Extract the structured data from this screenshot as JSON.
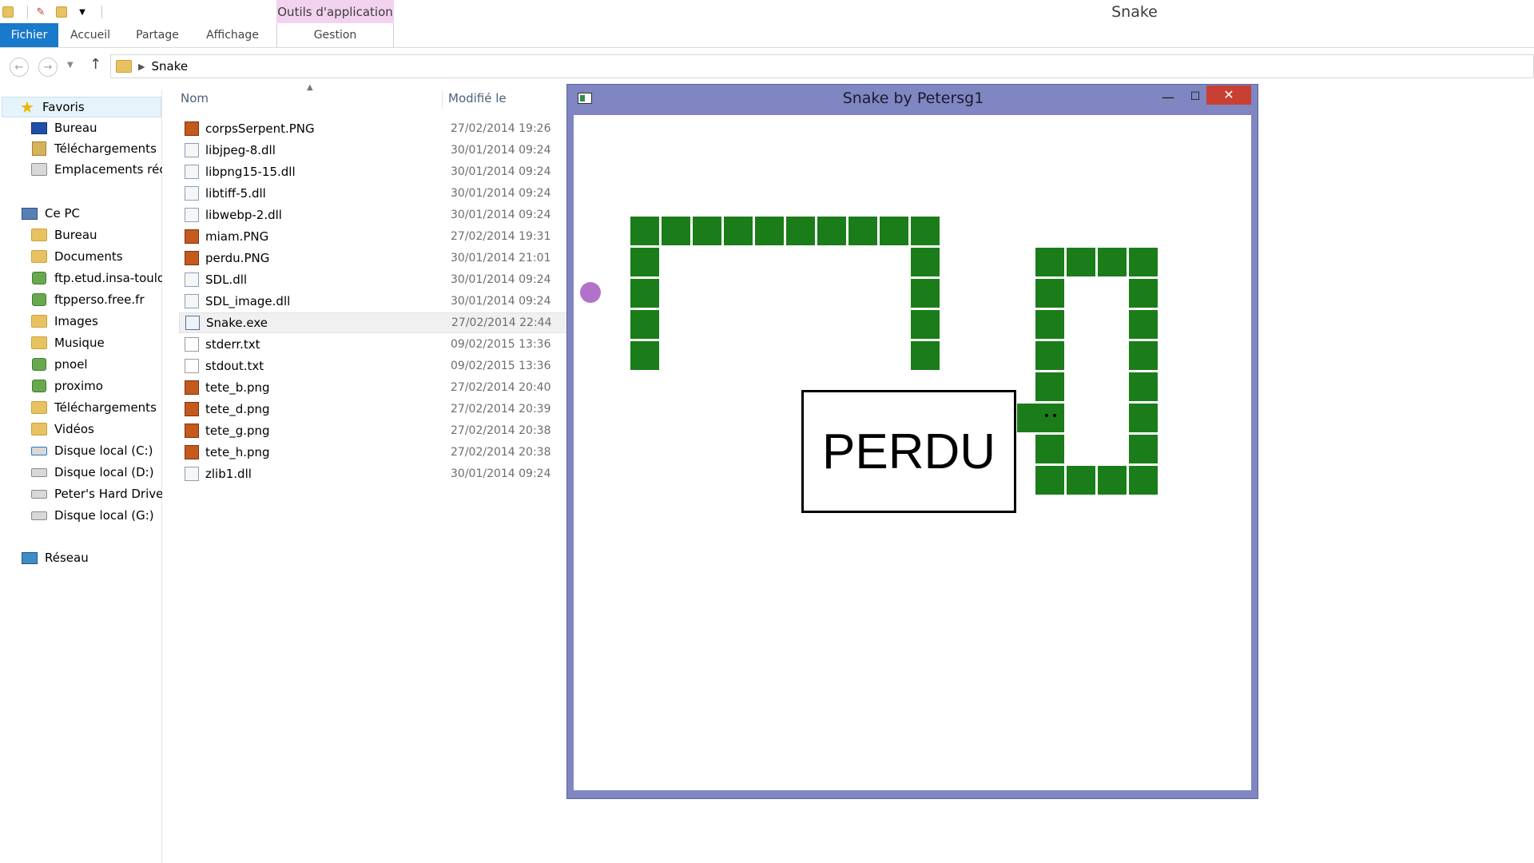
{
  "explorer": {
    "window_title": "Snake",
    "context_tab": "Outils d'application",
    "ribbon_tabs": {
      "fichier": "Fichier",
      "accueil": "Accueil",
      "partage": "Partage",
      "affichage": "Affichage",
      "gestion": "Gestion"
    },
    "address": {
      "path": "Snake"
    },
    "nav": {
      "favoris": "Favoris",
      "favoris_items": [
        "Bureau",
        "Téléchargements",
        "Emplacements récen"
      ],
      "ce_pc": "Ce PC",
      "pc_items": [
        "Bureau",
        "Documents",
        "ftp.etud.insa-toulou",
        "ftpperso.free.fr",
        "Images",
        "Musique",
        "pnoel",
        "proximo",
        "Téléchargements",
        "Vidéos",
        "Disque local (C:)",
        "Disque local (D:)",
        "Peter's Hard Drive (F",
        "Disque local (G:)"
      ],
      "reseau": "Réseau"
    },
    "columns": {
      "name": "Nom",
      "date": "Modifié le"
    },
    "files": [
      {
        "name": "corpsSerpent.PNG",
        "date": "27/02/2014 19:26",
        "type": "png"
      },
      {
        "name": "libjpeg-8.dll",
        "date": "30/01/2014 09:24",
        "type": "dll"
      },
      {
        "name": "libpng15-15.dll",
        "date": "30/01/2014 09:24",
        "type": "dll"
      },
      {
        "name": "libtiff-5.dll",
        "date": "30/01/2014 09:24",
        "type": "dll"
      },
      {
        "name": "libwebp-2.dll",
        "date": "30/01/2014 09:24",
        "type": "dll"
      },
      {
        "name": "miam.PNG",
        "date": "27/02/2014 19:31",
        "type": "png"
      },
      {
        "name": "perdu.PNG",
        "date": "30/01/2014 21:01",
        "type": "png"
      },
      {
        "name": "SDL.dll",
        "date": "30/01/2014 09:24",
        "type": "dll"
      },
      {
        "name": "SDL_image.dll",
        "date": "30/01/2014 09:24",
        "type": "dll"
      },
      {
        "name": "Snake.exe",
        "date": "27/02/2014 22:44",
        "type": "exe",
        "selected": true
      },
      {
        "name": "stderr.txt",
        "date": "09/02/2015 13:36",
        "type": "txt"
      },
      {
        "name": "stdout.txt",
        "date": "09/02/2015 13:36",
        "type": "txt"
      },
      {
        "name": "tete_b.png",
        "date": "27/02/2014 20:40",
        "type": "png"
      },
      {
        "name": "tete_d.png",
        "date": "27/02/2014 20:39",
        "type": "png"
      },
      {
        "name": "tete_g.png",
        "date": "27/02/2014 20:38",
        "type": "png"
      },
      {
        "name": "tete_h.png",
        "date": "27/02/2014 20:38",
        "type": "png"
      },
      {
        "name": "zlib1.dll",
        "date": "30/01/2014 09:24",
        "type": "dll"
      }
    ]
  },
  "snake_window": {
    "title": "Snake by Petersg1",
    "game_over_text": "PERDU",
    "colors": {
      "frame": "#8086c2",
      "snake": "#1a7d1a",
      "food": "#b372c9",
      "close": "#c84031"
    }
  }
}
